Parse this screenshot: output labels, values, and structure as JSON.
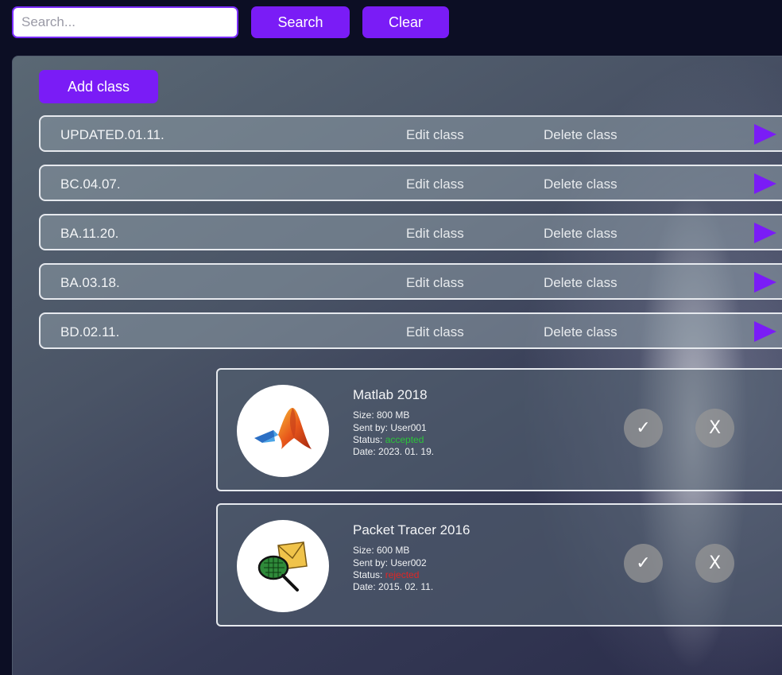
{
  "search": {
    "placeholder": "Search...",
    "value": ""
  },
  "toolbar": {
    "search_label": "Search",
    "clear_label": "Clear"
  },
  "panel": {
    "add_label": "Add class",
    "classes": [
      {
        "name": "UPDATED.01.11.",
        "edit_label": "Edit class",
        "delete_label": "Delete class"
      },
      {
        "name": "BC.04.07.",
        "edit_label": "Edit class",
        "delete_label": "Delete class"
      },
      {
        "name": "BA.11.20.",
        "edit_label": "Edit class",
        "delete_label": "Delete class"
      },
      {
        "name": "BA.03.18.",
        "edit_label": "Edit class",
        "delete_label": "Delete class"
      },
      {
        "name": "BD.02.11.",
        "edit_label": "Edit class",
        "delete_label": "Delete class"
      }
    ],
    "requests": [
      {
        "title": "Matlab 2018",
        "size": "Size: 800 MB",
        "sent_by": "Sent by: User001",
        "status_label": "Status:",
        "status_value": "accepted",
        "date": "Date: 2023. 01. 19.",
        "accept_label": "✓",
        "reject_label": "X",
        "icon": "matlab-logo-icon"
      },
      {
        "title": "Packet Tracer 2016",
        "size": "Size: 600 MB",
        "sent_by": "Sent by: User002",
        "status_label": "Status:",
        "status_value": "rejected",
        "date": "Date: 2015. 02. 11.",
        "accept_label": "✓",
        "reject_label": "X",
        "icon": "packet-tracer-logo-icon"
      }
    ]
  },
  "colors": {
    "accent": "#7a1cf6",
    "background": "#0c0e24",
    "status_accepted": "#2cc43a",
    "status_rejected": "#e02525"
  }
}
